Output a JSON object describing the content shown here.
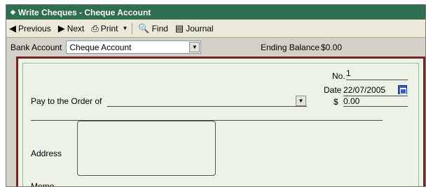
{
  "window": {
    "title": "Write Cheques - Cheque Account"
  },
  "toolbar": {
    "previous": "Previous",
    "next": "Next",
    "print": "Print",
    "find": "Find",
    "journal": "Journal"
  },
  "account_row": {
    "bank_account_label": "Bank Account",
    "bank_account_value": "Cheque Account",
    "ending_balance_label": "Ending Balance",
    "ending_balance_value": "$0.00"
  },
  "cheque": {
    "no_label": "No.",
    "no_value": "1",
    "date_label": "Date",
    "date_value": "22/07/2005",
    "pay_to_label": "Pay to the Order of",
    "pay_to_value": "",
    "amount_symbol": "$",
    "amount_value": "0.00",
    "address_label": "Address",
    "memo_label": "Memo"
  },
  "colors": {
    "title_bar": "#2f6e4f",
    "cheque_bg": "#eaf3e6",
    "cheque_border": "#7b2324"
  }
}
